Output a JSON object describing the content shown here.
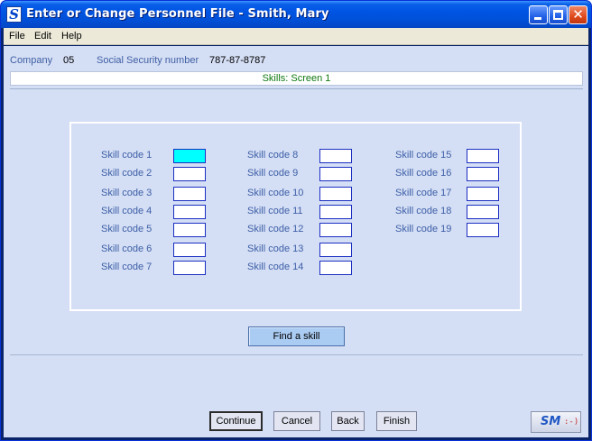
{
  "window": {
    "app_icon_letter": "S",
    "title": "Enter or Change Personnel File - Smith, Mary"
  },
  "menu": [
    "File",
    "Edit",
    "Help"
  ],
  "info": {
    "company_label": "Company",
    "company_value": "05",
    "ssn_label": "Social Security number",
    "ssn_value": "787-87-8787"
  },
  "screen_title": "Skills: Screen 1",
  "skills": {
    "col1": [
      "Skill code 1",
      "Skill code 2",
      "Skill code 3",
      "Skill code 4",
      "Skill code 5",
      "Skill code 6",
      "Skill code 7"
    ],
    "col2": [
      "Skill code 8",
      "Skill code 9",
      "Skill code 10",
      "Skill code 11",
      "Skill code 12",
      "Skill code 13",
      "Skill code 14"
    ],
    "col3": [
      "Skill code 15",
      "Skill code 16",
      "Skill code 17",
      "Skill code 18",
      "Skill code 19"
    ],
    "values": [
      "",
      "",
      "",
      "",
      "",
      "",
      "",
      "",
      "",
      "",
      "",
      "",
      "",
      "",
      "",
      "",
      "",
      "",
      ""
    ]
  },
  "buttons": {
    "find_skill": "Find a skill",
    "continue": "Continue",
    "cancel": "Cancel",
    "back": "Back",
    "finish": "Finish"
  },
  "logo": {
    "text": "SM",
    "face": ":-)"
  },
  "colors": {
    "active_field": "#00ffff",
    "label_blue": "#3d5fa7",
    "screen_title_green": "#117a11",
    "client_background": "#d4def4"
  }
}
